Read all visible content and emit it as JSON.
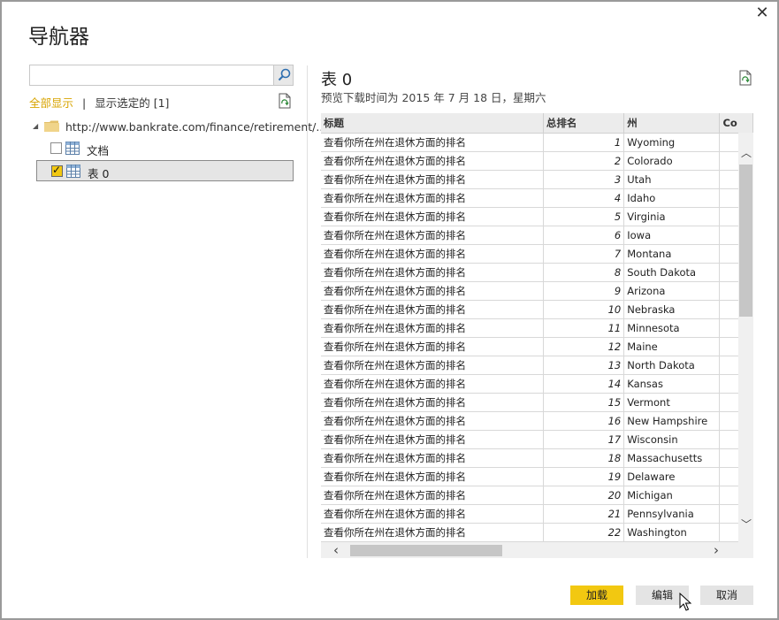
{
  "window": {
    "title": "导航器",
    "close_glyph": "✕"
  },
  "search": {
    "value": "",
    "placeholder": ""
  },
  "filter": {
    "show_all": "全部显示",
    "separator": "|",
    "show_selected": "显示选定的 [1]"
  },
  "tree": {
    "root_url": "http://www.bankrate.com/finance/retirement/...",
    "items": [
      {
        "label": "文档",
        "checked": false
      },
      {
        "label": "表 0",
        "checked": true
      }
    ]
  },
  "preview": {
    "title": "表 0",
    "subtitle": "预览下载时间为 2015 年 7 月 18 日，星期六",
    "columns": [
      "标题",
      "总排名",
      "州",
      "Co"
    ],
    "rows": [
      [
        "查看你所在州在退休方面的排名",
        "1",
        "Wyoming"
      ],
      [
        "查看你所在州在退休方面的排名",
        "2",
        "Colorado"
      ],
      [
        "查看你所在州在退休方面的排名",
        "3",
        "Utah"
      ],
      [
        "查看你所在州在退休方面的排名",
        "4",
        "Idaho"
      ],
      [
        "查看你所在州在退休方面的排名",
        "5",
        "Virginia"
      ],
      [
        "查看你所在州在退休方面的排名",
        "6",
        "Iowa"
      ],
      [
        "查看你所在州在退休方面的排名",
        "7",
        "Montana"
      ],
      [
        "查看你所在州在退休方面的排名",
        "8",
        "South Dakota"
      ],
      [
        "查看你所在州在退休方面的排名",
        "9",
        "Arizona"
      ],
      [
        "查看你所在州在退休方面的排名",
        "10",
        "Nebraska"
      ],
      [
        "查看你所在州在退休方面的排名",
        "11",
        "Minnesota"
      ],
      [
        "查看你所在州在退休方面的排名",
        "12",
        "Maine"
      ],
      [
        "查看你所在州在退休方面的排名",
        "13",
        "North Dakota"
      ],
      [
        "查看你所在州在退休方面的排名",
        "14",
        "Kansas"
      ],
      [
        "查看你所在州在退休方面的排名",
        "15",
        "Vermont"
      ],
      [
        "查看你所在州在退休方面的排名",
        "16",
        "New Hampshire"
      ],
      [
        "查看你所在州在退休方面的排名",
        "17",
        "Wisconsin"
      ],
      [
        "查看你所在州在退休方面的排名",
        "18",
        "Massachusetts"
      ],
      [
        "查看你所在州在退休方面的排名",
        "19",
        "Delaware"
      ],
      [
        "查看你所在州在退休方面的排名",
        "20",
        "Michigan"
      ],
      [
        "查看你所在州在退休方面的排名",
        "21",
        "Pennsylvania"
      ],
      [
        "查看你所在州在退休方面的排名",
        "22",
        "Washington"
      ]
    ]
  },
  "buttons": {
    "load": "加载",
    "edit": "编辑",
    "cancel": "取消"
  },
  "colors": {
    "accent": "#f2c811",
    "filter_active": "#d8a400"
  }
}
